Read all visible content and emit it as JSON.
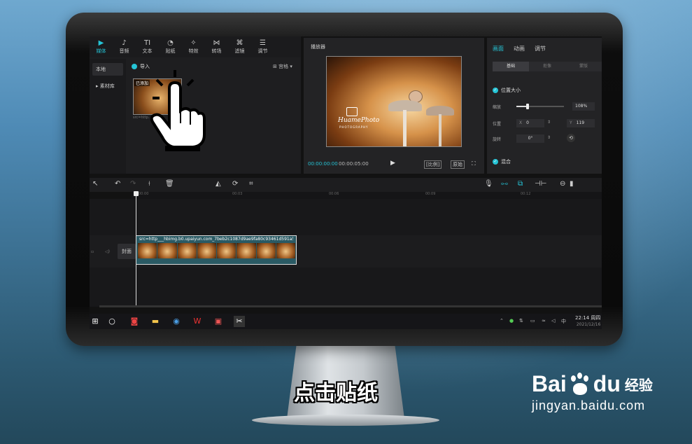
{
  "toolbar": {
    "items": [
      {
        "label": "媒体",
        "icon": "media-icon",
        "glyph": "▶"
      },
      {
        "label": "音频",
        "icon": "audio-icon",
        "glyph": "♪"
      },
      {
        "label": "文本",
        "icon": "text-icon",
        "glyph": "TI"
      },
      {
        "label": "贴纸",
        "icon": "sticker-icon",
        "glyph": "◔"
      },
      {
        "label": "特效",
        "icon": "effects-icon",
        "glyph": "✧"
      },
      {
        "label": "转场",
        "icon": "transition-icon",
        "glyph": "⋈"
      },
      {
        "label": "滤镜",
        "icon": "filter-icon",
        "glyph": "⌘"
      },
      {
        "label": "调节",
        "icon": "adjust-icon",
        "glyph": "☰"
      }
    ]
  },
  "media": {
    "sidebar": [
      "本地",
      "▸ 素材库"
    ],
    "import_label": "导入",
    "sort_label": "⊞ 宫格 ▾",
    "thumb_tag": "已添加",
    "thumb_name": "src=http...",
    "thumb_duration": "00:05"
  },
  "player": {
    "title": "播放器",
    "watermark": "HuamePhoto",
    "watermark_sub": "PHOTOGRAPHY",
    "time_current": "00:00:00:00",
    "time_total": "00:00:05:00",
    "play_glyph": "▶",
    "ratio_label": "原始",
    "ratio_btn_label": "[比例]",
    "fullscreen_glyph": "⛶"
  },
  "props": {
    "tabs": [
      "画面",
      "动画",
      "调节"
    ],
    "subtabs": [
      "基础",
      "抠像",
      "蒙版"
    ],
    "section_position": "位置大小",
    "scale_label": "缩放",
    "scale_value": "108%",
    "position_label": "位置",
    "x_prefix": "X",
    "x_value": "0",
    "y_prefix": "Y",
    "y_value": "119",
    "rotate_label": "旋转",
    "rotate_value": "0°",
    "section_blend": "混合"
  },
  "timeline": {
    "ruler": [
      "00:00",
      "00:03",
      "00:06",
      "00:09",
      "00:12"
    ],
    "cover_label": "封面",
    "clip_name": "src=http___hbimg.b0.upaiyun.com_7beb2c1087d9ae9fa80c93461d591a5993"
  },
  "taskbar": {
    "time": "22:14 周四",
    "date": "2021/12/16"
  },
  "caption": "点击贴纸",
  "watermark": {
    "brand_left": "Bai",
    "brand_right": "du",
    "brand_cn": "经验",
    "url": "jingyan.baidu.com"
  }
}
